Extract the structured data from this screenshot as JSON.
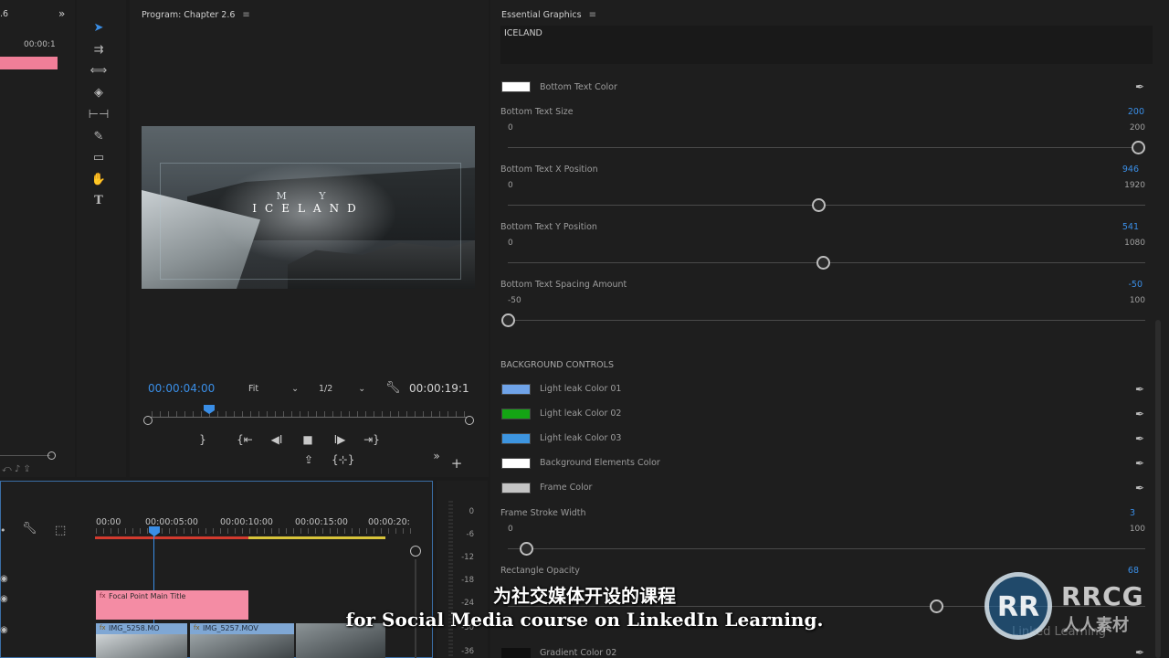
{
  "left_strip": {
    "header_fragment": ".6",
    "timecode": "00:00:1"
  },
  "tools": {
    "items": [
      "selection-tool",
      "track-select-tool",
      "ripple-edit-tool",
      "razor-tool",
      "slip-tool",
      "pen-tool",
      "rectangle-tool",
      "hand-tool",
      "type-tool"
    ]
  },
  "program": {
    "title": "Program: Chapter 2.6",
    "video_title_top": "M Y",
    "video_title_main": "ICELAND",
    "current_timecode": "00:00:04:00",
    "fit_label": "Fit",
    "resolution_label": "1/2",
    "duration_timecode": "00:00:19:1"
  },
  "essential_graphics": {
    "title": "Essential Graphics",
    "text_value": "ICELAND",
    "bottom_text_color_label": "Bottom Text Color",
    "bottom_text_color": "#ffffff",
    "bottom_text_size": {
      "label": "Bottom Text Size",
      "value": "200",
      "min": "0",
      "max": "200",
      "fraction": 1.0
    },
    "bottom_text_x": {
      "label": "Bottom Text X Position",
      "value": "946",
      "min": "0",
      "max": "1920",
      "fraction": 0.493
    },
    "bottom_text_y": {
      "label": "Bottom Text Y Position",
      "value": "541",
      "min": "0",
      "max": "1080",
      "fraction": 0.501
    },
    "bottom_text_spacing": {
      "label": "Bottom Text Spacing Amount",
      "value": "-50",
      "min": "-50",
      "max": "100",
      "fraction": 0.0
    },
    "background_section": "BACKGROUND CONTROLS",
    "colors": [
      {
        "label": "Light leak Color 01",
        "color": "#6fa3e8"
      },
      {
        "label": "Light leak Color 02",
        "color": "#14a514"
      },
      {
        "label": "Light leak Color 03",
        "color": "#3d95e0"
      },
      {
        "label": "Background Elements Color",
        "color": "#ffffff"
      },
      {
        "label": "Frame Color",
        "color": "#c4c4c4"
      }
    ],
    "frame_stroke_width": {
      "label": "Frame Stroke Width",
      "value": "3",
      "min": "0",
      "max": "100",
      "fraction": 0.03
    },
    "rectangle_opacity": {
      "label": "Rectangle Opacity",
      "value": "68",
      "fraction": 0.68
    },
    "gradient_color_02_label": "Gradient Color 02"
  },
  "timeline": {
    "ruler": [
      "00:00",
      "00:00:05:00",
      "00:00:10:00",
      "00:00:15:00",
      "00:00:20:"
    ],
    "title_clip": "Focal Point Main Title",
    "clip_a": "IMG_5258.MO",
    "clip_b": "IMG_5257.MOV"
  },
  "meter": {
    "ticks": [
      "0",
      "-6",
      "-12",
      "-18",
      "-24",
      "-30",
      "-36"
    ]
  },
  "subtitles": {
    "chinese": "为社交媒体开设的课程",
    "english": "for Social Media course on LinkedIn Learning."
  },
  "watermark": {
    "brand": "RRCG",
    "sub": "人人素材",
    "ghost": "Linked Learning"
  }
}
